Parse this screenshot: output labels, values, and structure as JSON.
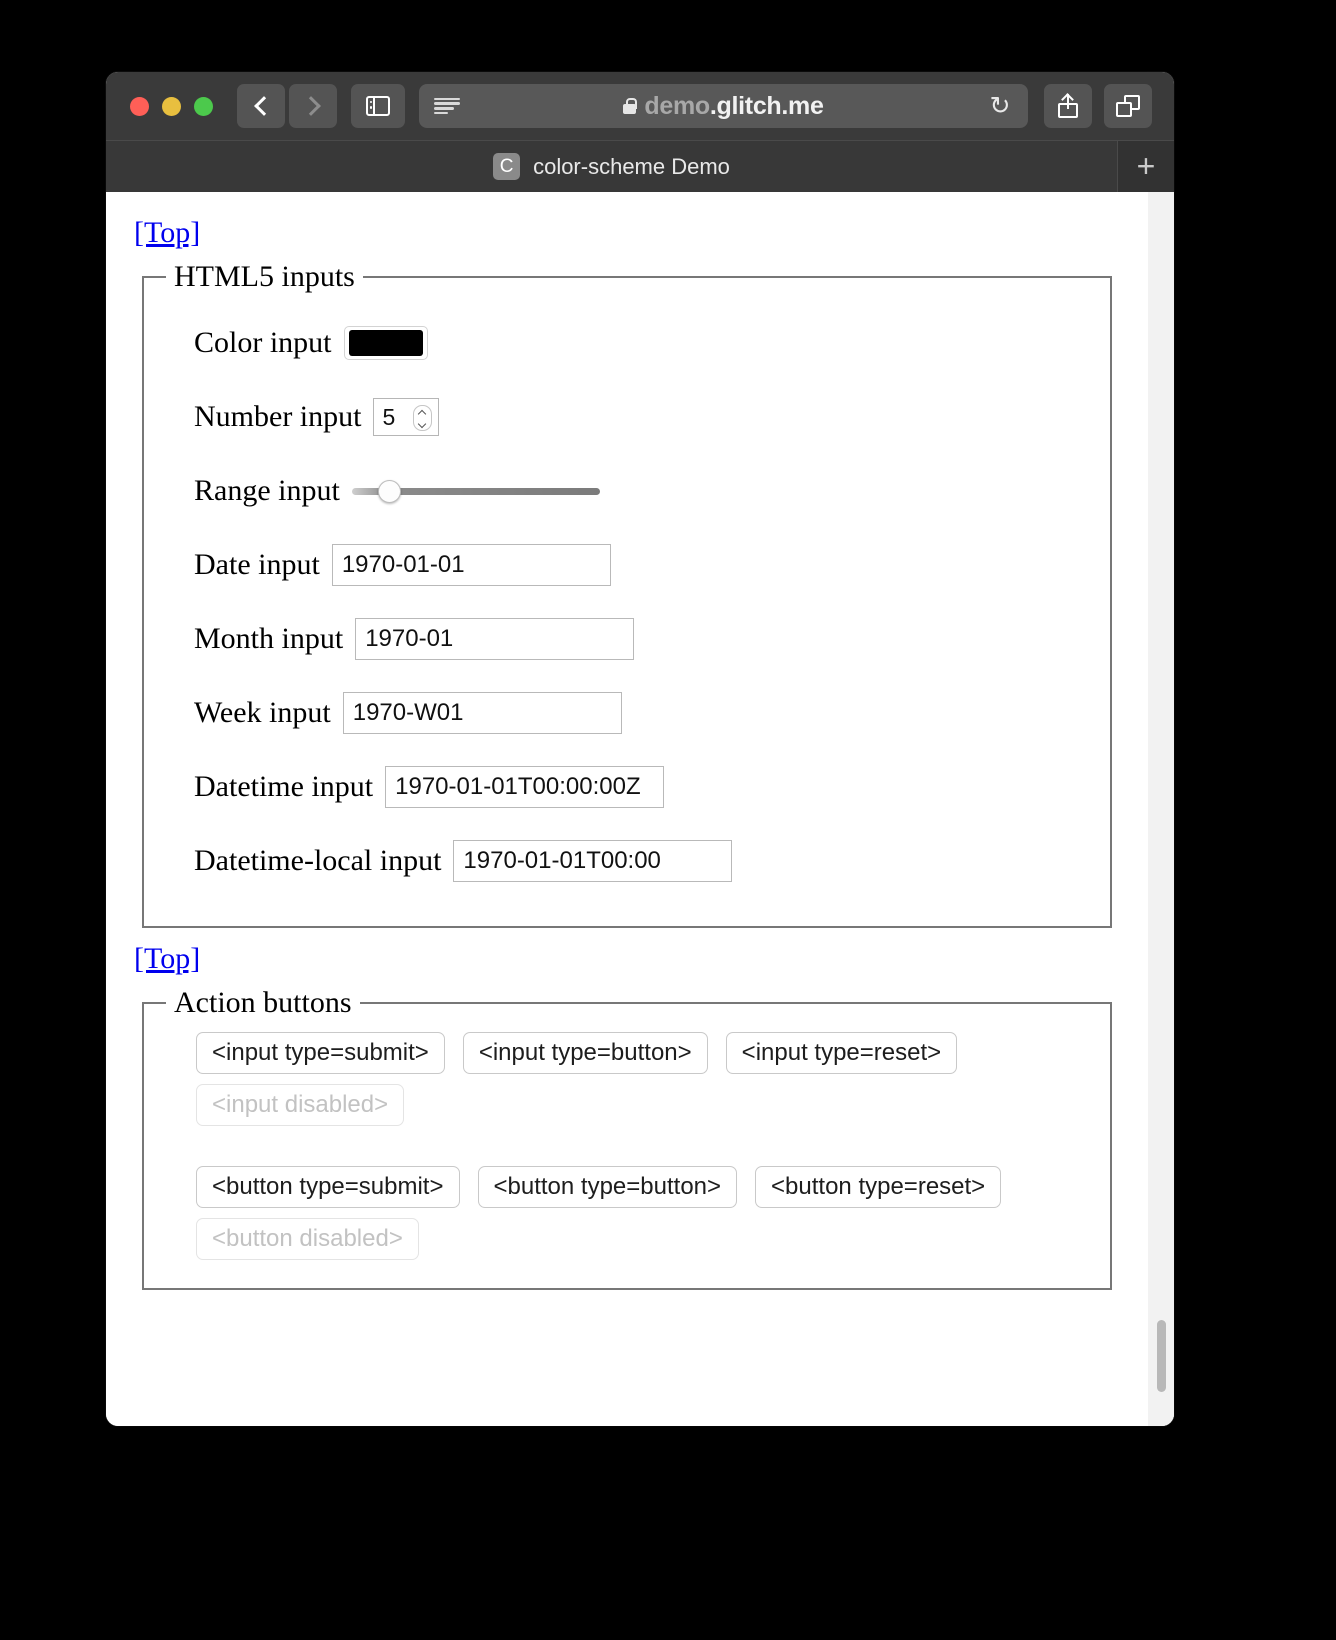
{
  "browser": {
    "traffic_lights": [
      "close",
      "minimize",
      "zoom"
    ],
    "nav": {
      "back_icon": "chevron-left-icon",
      "forward_icon": "chevron-right-icon"
    },
    "sidebar_icon": "sidebar-icon",
    "reader_icon": "reader-view-icon",
    "lock_icon": "lock-icon",
    "url_prefix": "demo",
    "url_suffix": ".glitch.me",
    "url_full": "demo.glitch.me",
    "reload_icon": "↻",
    "share_icon": "share-icon",
    "tabs_icon": "show-all-tabs-icon",
    "new_tab_label": "+",
    "tab": {
      "favicon_letter": "C",
      "title": "color-scheme Demo"
    },
    "colors": {
      "toolbar_bg": "#3a3a3a",
      "tabbar_bg": "#323232",
      "url_field_bg": "#585858",
      "accent_link": "#0000ee"
    }
  },
  "page": {
    "top_link_1": "[Top]",
    "top_link_2": "[Top]",
    "html5_inputs": {
      "legend": "HTML5 inputs",
      "fields": [
        {
          "label": "Color input",
          "kind": "color",
          "value": "#000000"
        },
        {
          "label": "Number input",
          "kind": "number",
          "value": "5"
        },
        {
          "label": "Range input",
          "kind": "range",
          "value": ""
        },
        {
          "label": "Date input",
          "kind": "text",
          "value": "1970-01-01"
        },
        {
          "label": "Month input",
          "kind": "text",
          "value": "1970-01"
        },
        {
          "label": "Week input",
          "kind": "text",
          "value": "1970-W01"
        },
        {
          "label": "Datetime input",
          "kind": "text",
          "value": "1970-01-01T00:00:00Z"
        },
        {
          "label": "Datetime-local input",
          "kind": "text",
          "value": "1970-01-01T00:00"
        }
      ]
    },
    "action_buttons": {
      "legend": "Action buttons",
      "row1": [
        {
          "label": "<input type=submit>",
          "disabled": false
        },
        {
          "label": "<input type=button>",
          "disabled": false
        },
        {
          "label": "<input type=reset>",
          "disabled": false
        }
      ],
      "row2": [
        {
          "label": "<input disabled>",
          "disabled": true
        }
      ],
      "row3": [
        {
          "label": "<button type=submit>",
          "disabled": false
        },
        {
          "label": "<button type=button>",
          "disabled": false
        },
        {
          "label": "<button type=reset>",
          "disabled": false
        }
      ],
      "row4": [
        {
          "label": "<button disabled>",
          "disabled": true
        }
      ]
    }
  }
}
